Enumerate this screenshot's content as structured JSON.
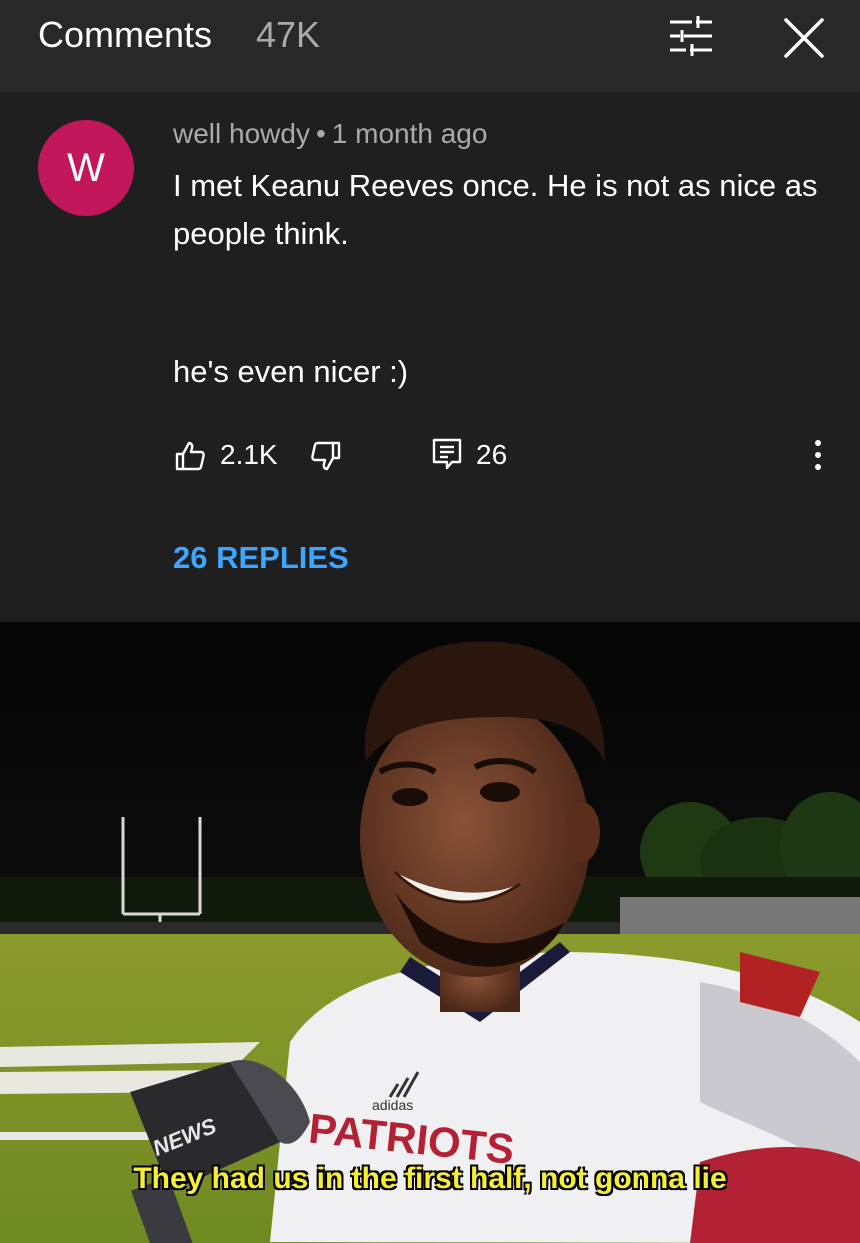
{
  "header": {
    "title": "Comments",
    "count": "47K",
    "filter_icon": "filter-sliders-icon",
    "close_icon": "close-icon"
  },
  "comment": {
    "avatar_letter": "W",
    "avatar_color": "#c2185b",
    "author": "well howdy",
    "separator": "•",
    "time": "1 month ago",
    "text_line1": "I met Keanu Reeves once. He is not as nice as people think.",
    "text_line2": "he's even nicer :)",
    "likes": "2.1K",
    "reply_count": "26",
    "replies_link": "26 REPLIES",
    "accent_color": "#3ea6ff"
  },
  "meme": {
    "caption": "They had us in the first half, not gonna lie",
    "mic_logo_text": "NEWS",
    "jersey_text": "PATRIOTS",
    "brand_text": "adidas",
    "caption_color": "#f6ed35"
  }
}
